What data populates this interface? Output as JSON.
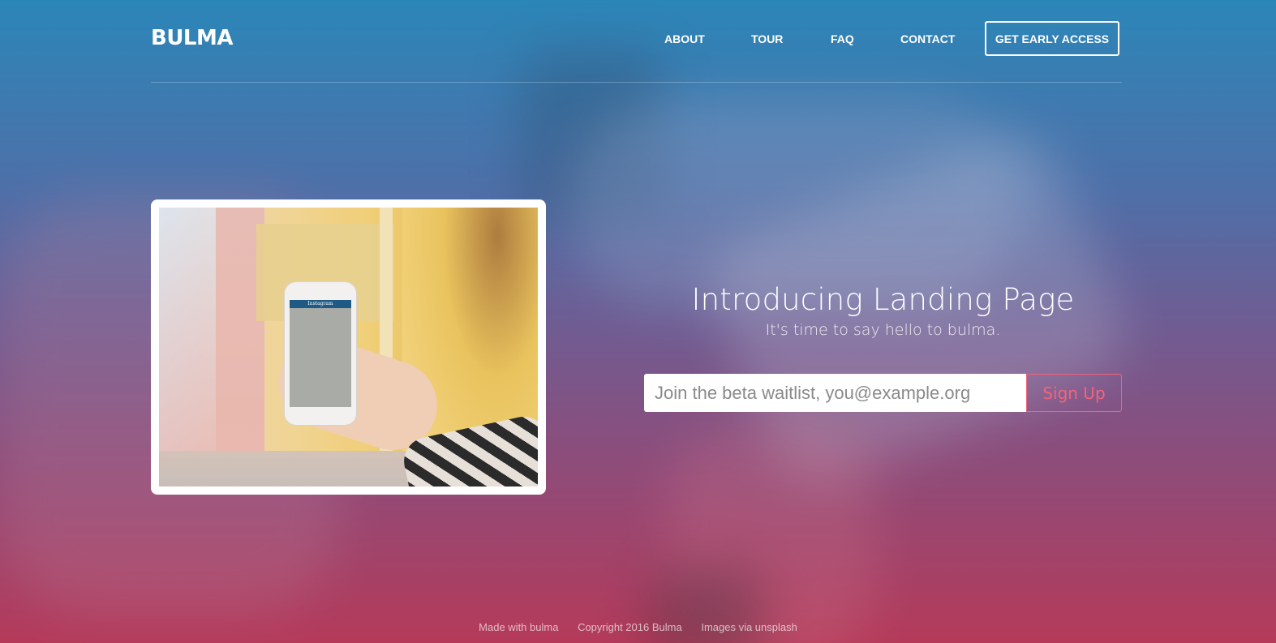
{
  "navbar": {
    "brand": "BULMA",
    "links": [
      "ABOUT",
      "TOUR",
      "FAQ",
      "CONTACT"
    ],
    "cta": "GET EARLY ACCESS"
  },
  "hero": {
    "title": "Introducing Landing Page",
    "subtitle": "It's time to say hello to bulma.",
    "image_label": "Instagram"
  },
  "form": {
    "email_placeholder": "Join the beta waitlist, you@example.org",
    "email_value": "",
    "submit_label": "Sign Up"
  },
  "footer": {
    "links": [
      "Made with bulma",
      "Copyright 2016 Bulma",
      "Images via unsplash"
    ]
  },
  "colors": {
    "gradient_top": "#2b86b8",
    "gradient_bottom": "#b53a5a",
    "accent": "#f5637a",
    "text_light": "#ffffff"
  }
}
